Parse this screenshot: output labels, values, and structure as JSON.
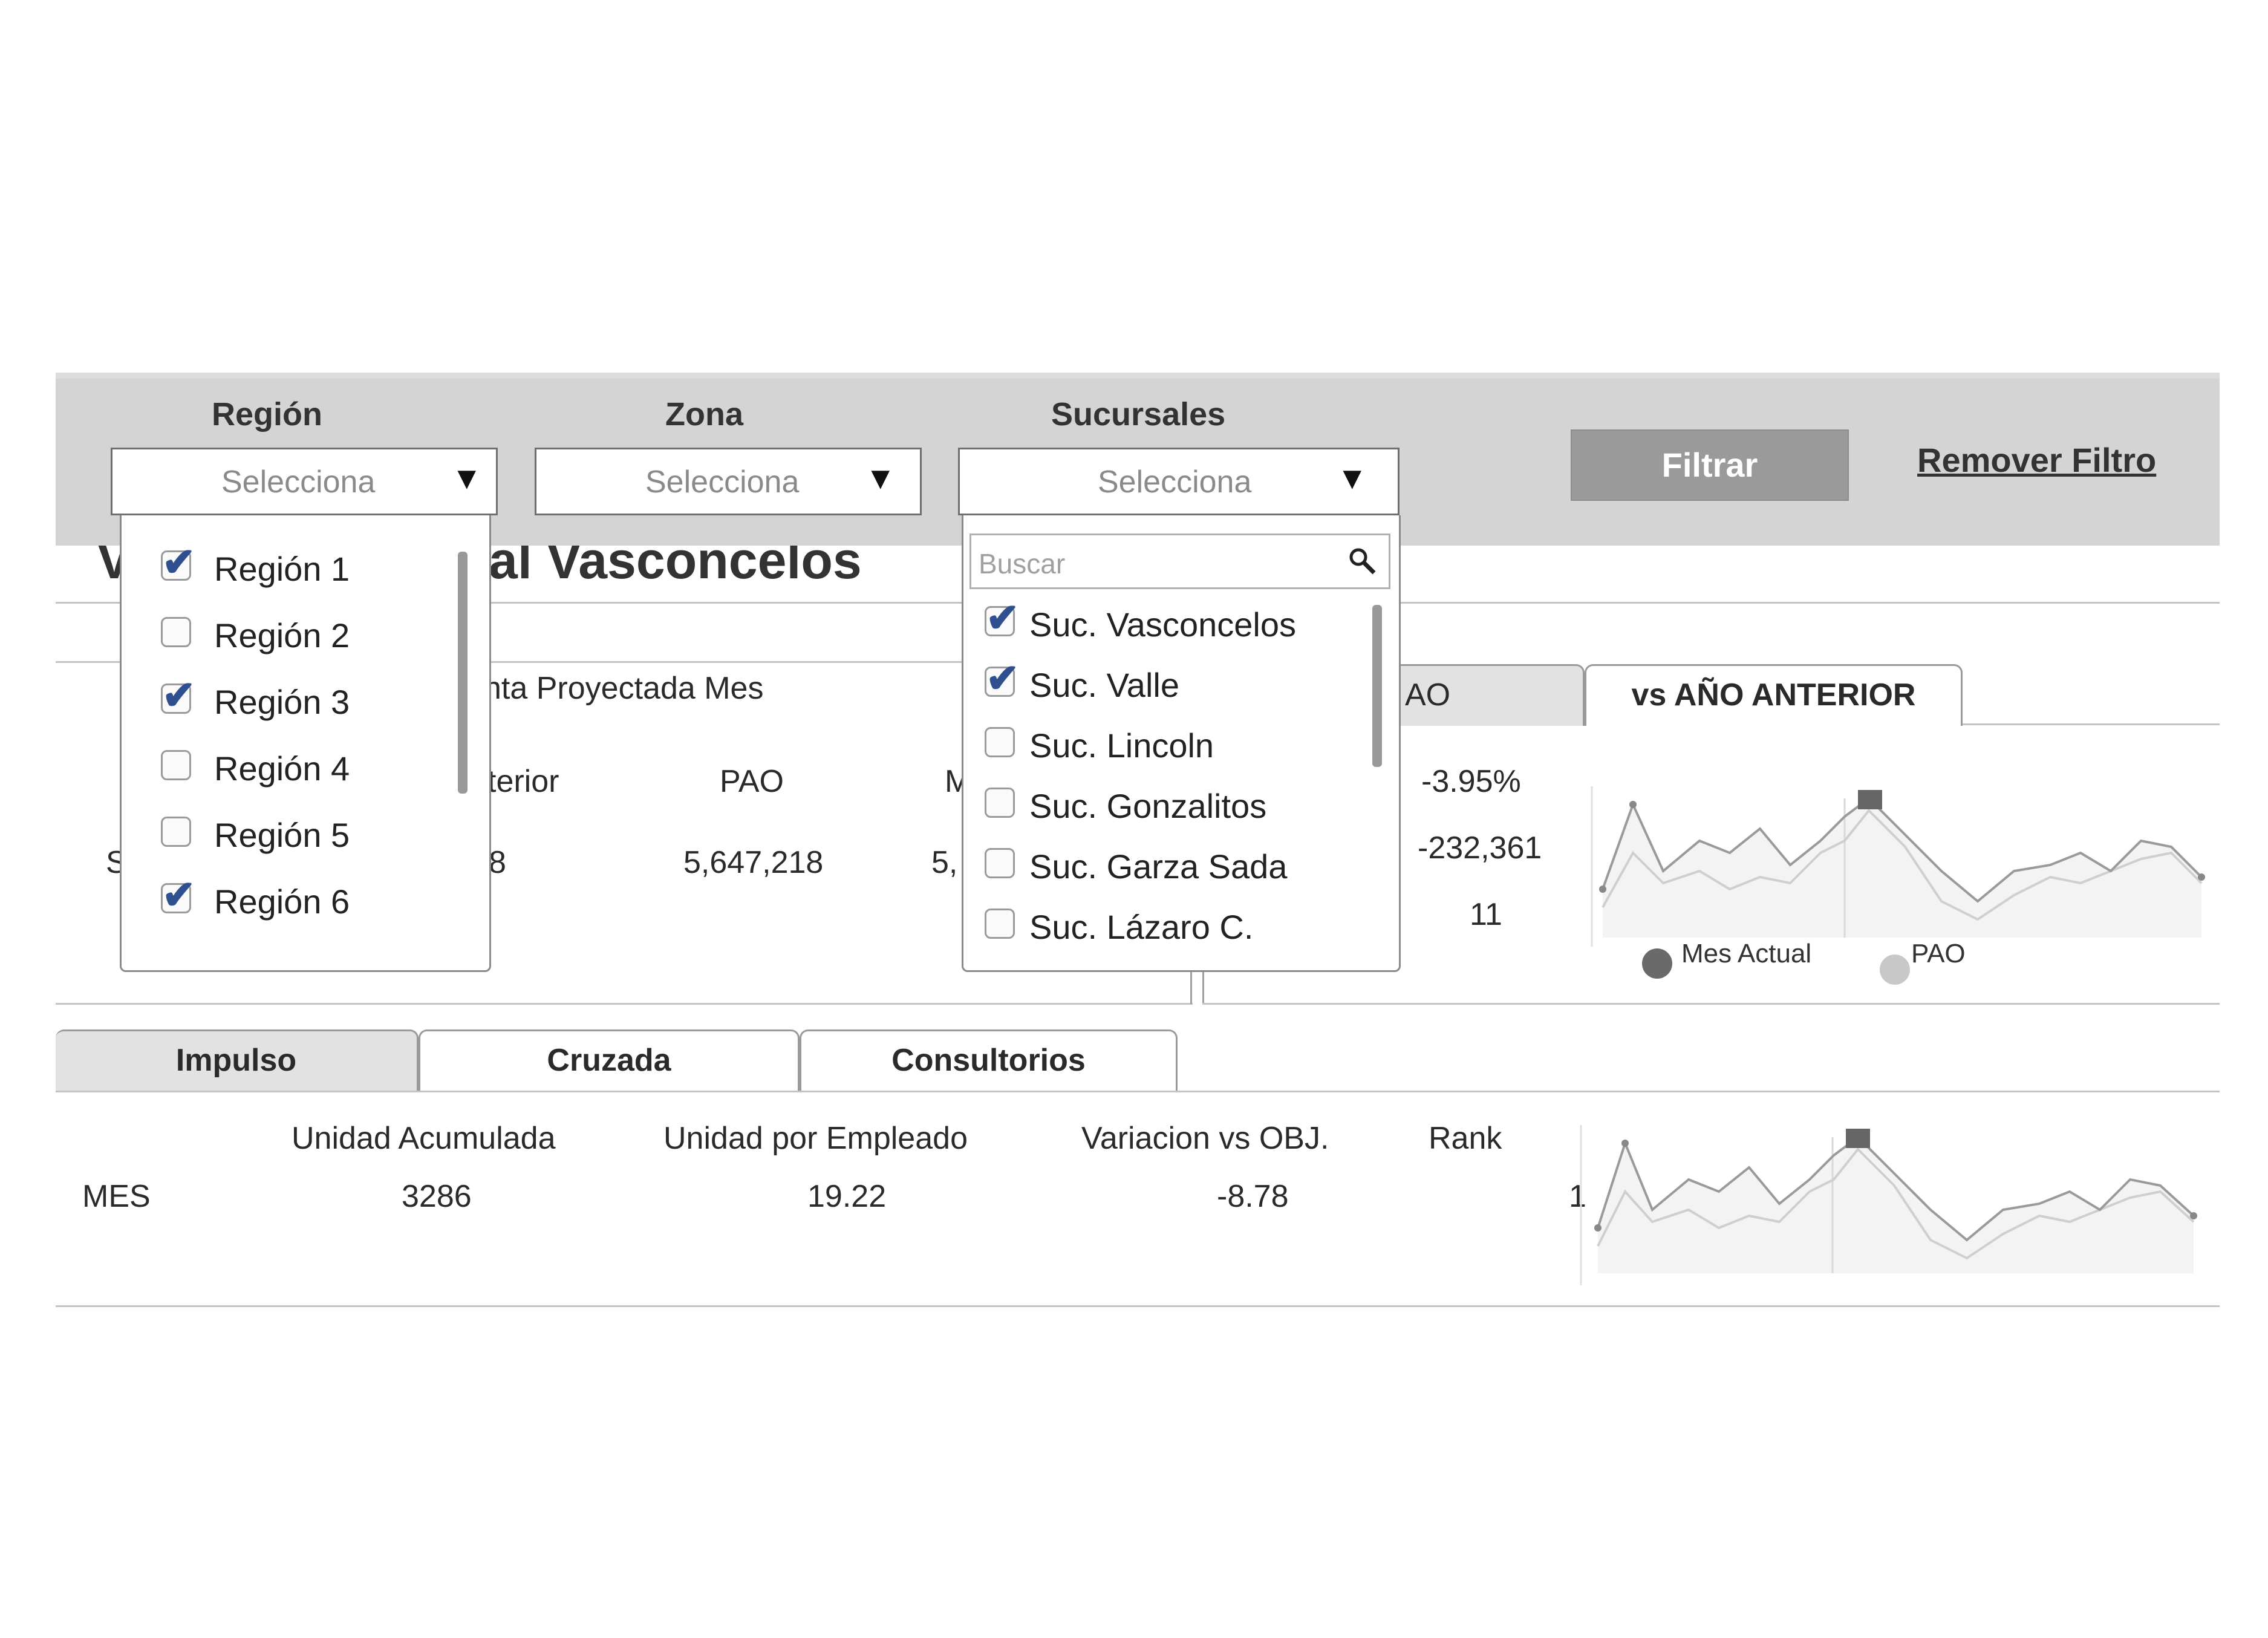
{
  "filters": {
    "region": {
      "label": "Región",
      "value": "Selecciona"
    },
    "zona": {
      "label": "Zona",
      "value": "Selecciona"
    },
    "sucursales": {
      "label": "Sucursales",
      "value": "Selecciona"
    },
    "filtrar_label": "Filtrar",
    "remover_label": "Remover Filtro"
  },
  "region_dropdown": {
    "items": [
      {
        "label": "Región 1",
        "checked": true
      },
      {
        "label": "Región 2",
        "checked": false
      },
      {
        "label": "Región 3",
        "checked": true
      },
      {
        "label": "Región 4",
        "checked": false
      },
      {
        "label": "Región 5",
        "checked": false
      },
      {
        "label": "Región 6",
        "checked": true
      }
    ]
  },
  "sucursales_dropdown": {
    "search_placeholder": "Buscar",
    "items": [
      {
        "label": "Suc. Vasconcelos",
        "checked": true
      },
      {
        "label": "Suc. Valle",
        "checked": true
      },
      {
        "label": "Suc. Lincoln",
        "checked": false
      },
      {
        "label": "Suc. Gonzalitos",
        "checked": false
      },
      {
        "label": "Suc. Garza Sada",
        "checked": false
      },
      {
        "label": "Suc. Lázaro C.",
        "checked": false
      }
    ]
  },
  "page_title_fragment": "al Vasconcelos",
  "venta_section": {
    "subtitle_fragment": "nta Proyectada Mes",
    "col_fragment_anterior": "terior",
    "col_pao": "PAO",
    "col_fragment_m": "M",
    "row_fragment_s": "S",
    "val_fragment_8": "8",
    "val_pao": "5,647,218",
    "val_fragment_5": "5,",
    "pct": "-3.95%",
    "diff": "-232,361",
    "rank": "11",
    "tab_fragment_ao": "AO",
    "tab_vs_anio": "vs AÑO ANTERIOR",
    "legend": {
      "mes_actual": "Mes Actual",
      "pao": "PAO"
    }
  },
  "bottom_tabs": [
    "Impulso",
    "Cruzada",
    "Consultorios"
  ],
  "impulso_table": {
    "headers": [
      "Unidad Acumulada",
      "Unidad por Empleado",
      "Variacion vs OBJ.",
      "Rank"
    ],
    "row_label": "MES",
    "values": [
      "3286",
      "19.22",
      "-8.78"
    ],
    "rank_fragment": "1"
  },
  "colors": {
    "filter_bar": "#d4d4d4",
    "button": "#9a9a9a",
    "check": "#2f4f8f",
    "series_dark": "#9a9a9a",
    "series_light": "#cfcfcf"
  }
}
